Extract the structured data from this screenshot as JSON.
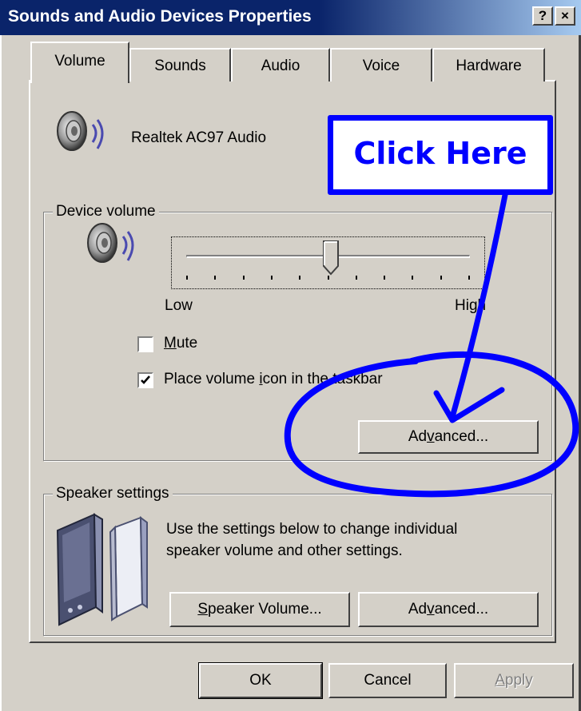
{
  "window": {
    "title": "Sounds and Audio Devices Properties",
    "help_label": "?",
    "close_label": "×"
  },
  "tabs": [
    {
      "label": "Volume",
      "selected": true
    },
    {
      "label": "Sounds",
      "selected": false
    },
    {
      "label": "Audio",
      "selected": false
    },
    {
      "label": "Voice",
      "selected": false
    },
    {
      "label": "Hardware",
      "selected": false
    }
  ],
  "device": {
    "name": "Realtek AC97 Audio",
    "icon": "speaker-icon"
  },
  "device_volume": {
    "group_label": "Device volume",
    "low_label": "Low",
    "high_label": "High",
    "level_fraction": 0.51,
    "mute_label_u": "M",
    "mute_label_rest": "ute",
    "mute_checked": false,
    "taskbar_label_pre": "Place volume ",
    "taskbar_label_u": "i",
    "taskbar_label_rest": "con in the taskbar",
    "taskbar_checked": true,
    "advanced_pre": "Ad",
    "advanced_u": "v",
    "advanced_rest": "anced..."
  },
  "annotation": {
    "callout_text": "Click Here",
    "color": "#0000ff"
  },
  "speaker_settings": {
    "group_label": "Speaker settings",
    "description_line1": "Use the settings below to change individual",
    "description_line2": "speaker volume and other settings.",
    "speaker_volume_u": "S",
    "speaker_volume_rest": "peaker Volume...",
    "advanced_pre": "Ad",
    "advanced_u": "v",
    "advanced_rest": "anced..."
  },
  "footer": {
    "ok_label": "OK",
    "cancel_label": "Cancel",
    "apply_u": "A",
    "apply_rest": "pply",
    "apply_enabled": false
  },
  "colors": {
    "face": "#d4d0c8",
    "title_start": "#0a246a",
    "title_end": "#a6caf0",
    "annotation": "#0000ff"
  }
}
